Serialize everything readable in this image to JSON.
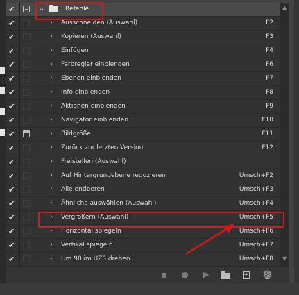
{
  "group": {
    "name": "Befehle",
    "checked": true
  },
  "actions": [
    {
      "label": "Ausschneiden (Auswahl)",
      "key": "F2",
      "dialog": false
    },
    {
      "label": "Kopieren (Auswahl)",
      "key": "F3",
      "dialog": false
    },
    {
      "label": "Einfügen",
      "key": "F4",
      "dialog": false
    },
    {
      "label": "Farbregler einblenden",
      "key": "F6",
      "dialog": false
    },
    {
      "label": "Ebenen einblenden",
      "key": "F7",
      "dialog": false
    },
    {
      "label": "Info einblenden",
      "key": "F8",
      "dialog": false
    },
    {
      "label": "Aktionen einblenden",
      "key": "F9",
      "dialog": false
    },
    {
      "label": "Navigator einblenden",
      "key": "F10",
      "dialog": false
    },
    {
      "label": "Bildgröße",
      "key": "F11",
      "dialog": true
    },
    {
      "label": "Zurück zur letzten Version",
      "key": "F12",
      "dialog": false
    },
    {
      "label": "Freistellen (Auswahl)",
      "key": "",
      "dialog": false
    },
    {
      "label": "Auf Hintergrundebene reduzieren",
      "key": "Umsch+F2",
      "dialog": false
    },
    {
      "label": "Alle entleeren",
      "key": "Umsch+F3",
      "dialog": false
    },
    {
      "label": "Ähnliche auswählen (Auswahl)",
      "key": "Umsch+F4",
      "dialog": false
    },
    {
      "label": "Vergrößern (Auswahl)",
      "key": "Umsch+F5",
      "dialog": false
    },
    {
      "label": "Horizontal spiegeln",
      "key": "Umsch+F6",
      "dialog": false
    },
    {
      "label": "Vertikal spiegeln",
      "key": "Umsch+F7",
      "dialog": false
    },
    {
      "label": "Um 90 im UZS drehen",
      "key": "Umsch+F8",
      "dialog": false
    }
  ],
  "icons": {
    "check": "✔",
    "chevron_right": "›",
    "chevron_down": "⌄",
    "play": "▶",
    "trash": "🗑",
    "plus": "+",
    "scroll_up": "▲",
    "scroll_down": "▼"
  },
  "colors": {
    "highlight": "#d11a1a",
    "panel": "#323232",
    "group_row": "#4a4a4a"
  }
}
